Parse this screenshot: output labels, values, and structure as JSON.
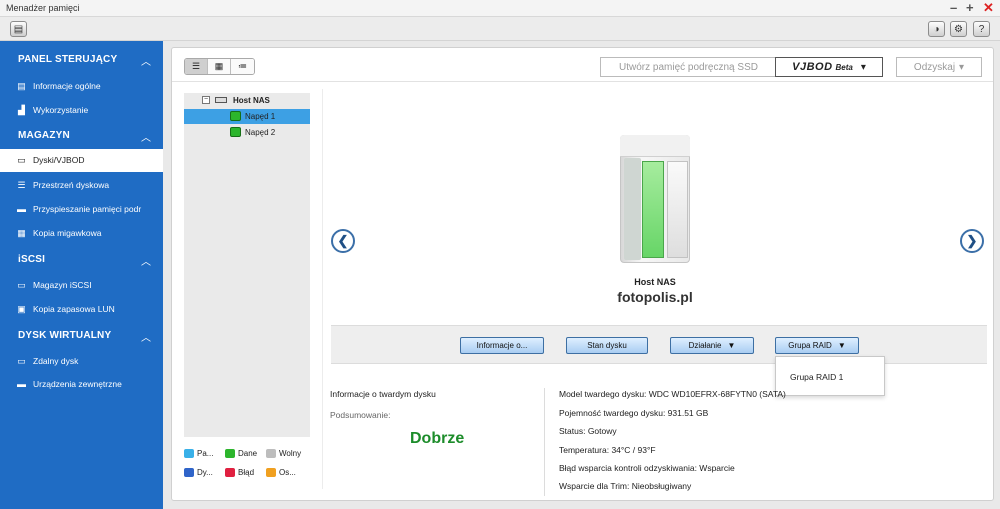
{
  "window": {
    "title": "Menadżer pamięci"
  },
  "sidebar": {
    "sections": [
      {
        "title": "PANEL STERUJĄCY",
        "items": [
          {
            "label": "Informacje ogólne",
            "icon": "info-list-icon"
          },
          {
            "label": "Wykorzystanie",
            "icon": "chart-icon"
          }
        ]
      },
      {
        "title": "MAGAZYN",
        "items": [
          {
            "label": "Dyski/VJBOD",
            "icon": "disk-icon",
            "active": true
          },
          {
            "label": "Przestrzeń dyskowa",
            "icon": "storage-icon"
          },
          {
            "label": "Przyspieszanie pamięci podr",
            "icon": "cache-icon"
          },
          {
            "label": "Kopia migawkowa",
            "icon": "snapshot-icon"
          }
        ]
      },
      {
        "title": "iSCSI",
        "items": [
          {
            "label": "Magazyn iSCSI",
            "icon": "iscsi-icon"
          },
          {
            "label": "Kopia zapasowa LUN",
            "icon": "lun-backup-icon"
          }
        ]
      },
      {
        "title": "DYSK WIRTUALNY",
        "items": [
          {
            "label": "Zdalny dysk",
            "icon": "remote-disk-icon"
          },
          {
            "label": "Urządzenia zewnętrzne",
            "icon": "external-device-icon"
          }
        ]
      }
    ]
  },
  "toolbar": {
    "ssd_cache_label": "Utwórz pamięć podręczną SSD",
    "vjbod_brand": "VJBOD",
    "vjbod_beta": "Beta",
    "recover_label": "Odzyskaj"
  },
  "tree": {
    "host": "Host NAS",
    "drives": [
      "Napęd 1",
      "Napęd 2"
    ]
  },
  "legend": [
    {
      "label": "Pa...",
      "color": "#39b0e8"
    },
    {
      "label": "Dane",
      "color": "#2cb52c"
    },
    {
      "label": "Wolny",
      "color": "#bdbdbd"
    },
    {
      "label": "Dy...",
      "color": "#2f64c9"
    },
    {
      "label": "Błąd",
      "color": "#e02040"
    },
    {
      "label": "Os...",
      "color": "#f0a020"
    }
  ],
  "device": {
    "name": "Host NAS",
    "watermark": "fotopolis.pl"
  },
  "actions": {
    "info": "Informacje o...",
    "status": "Stan dysku",
    "action": "Działanie",
    "raid": "Grupa RAID"
  },
  "raid_dropdown": {
    "items": [
      "Grupa RAID 1"
    ]
  },
  "disk_info": {
    "title": "Informacje o twardym dysku",
    "summary_label": "Podsumowanie:",
    "summary_value": "Dobrze",
    "details": [
      "Model twardego dysku: WDC WD10EFRX-68FYTN0 (SATA)",
      "Pojemność twardego dysku: 931.51 GB",
      "Status: Gotowy",
      "Temperatura: 34°C / 93°F",
      "Błąd wsparcia kontroli odzyskiwania: Wsparcie",
      "Wsparcie dla Trim: Nieobsługiwany"
    ]
  }
}
